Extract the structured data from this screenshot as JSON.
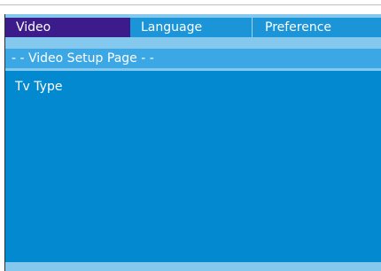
{
  "tabs": [
    {
      "label": "Video",
      "active": true
    },
    {
      "label": "Language",
      "active": false
    },
    {
      "label": "Preference",
      "active": false
    }
  ],
  "header": {
    "title": "- - Video Setup Page - -"
  },
  "menu": {
    "items": [
      "Tv Type"
    ]
  },
  "colors": {
    "active_tab": "#3c1c8a",
    "inactive_tab": "#1b95d8",
    "header_band": "#3ba7e4",
    "content": "#0389cf",
    "frame": "#85c8ee",
    "text": "#ffffff"
  }
}
